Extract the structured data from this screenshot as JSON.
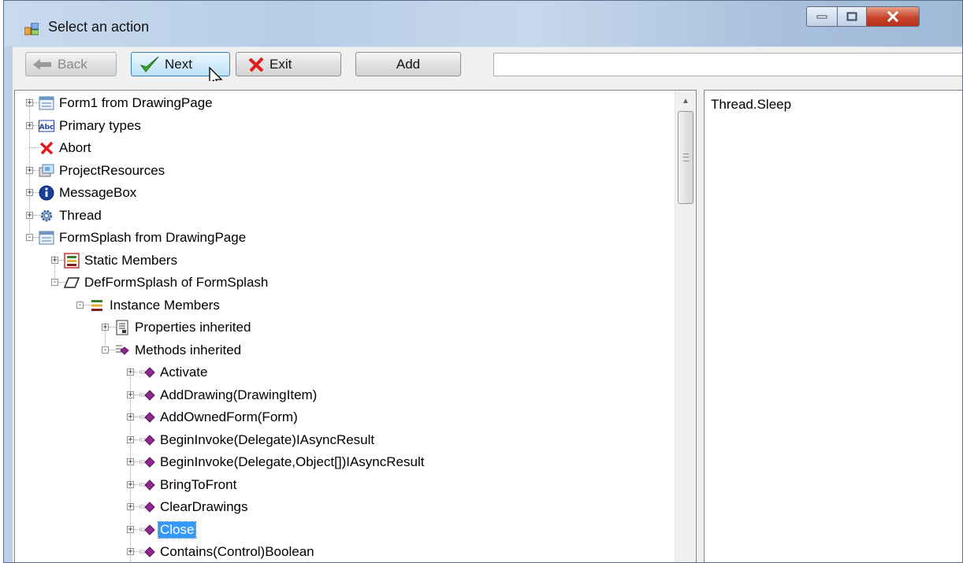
{
  "window": {
    "title": "Select an action"
  },
  "toolbar": {
    "back_label": "Back",
    "next_label": "Next",
    "exit_label": "Exit",
    "add_label": "Add",
    "address_value": ""
  },
  "detail": {
    "text": "Thread.Sleep"
  },
  "tree": {
    "items": [
      {
        "label": "Form1 from DrawingPage",
        "icon": "form-icon",
        "expander": "+",
        "selected": false
      },
      {
        "label": "Primary types",
        "icon": "abc-icon",
        "expander": "+",
        "selected": false
      },
      {
        "label": "Abort",
        "icon": "red-x-icon",
        "expander": "",
        "selected": false
      },
      {
        "label": "ProjectResources",
        "icon": "resources-icon",
        "expander": "+",
        "selected": false
      },
      {
        "label": "MessageBox",
        "icon": "info-icon",
        "expander": "+",
        "selected": false
      },
      {
        "label": "Thread",
        "icon": "gear-icon",
        "expander": "+",
        "selected": false
      },
      {
        "label": "FormSplash from DrawingPage",
        "icon": "form-icon",
        "expander": "-",
        "selected": false
      },
      {
        "label": "Static Members",
        "icon": "static-members-icon",
        "expander": "+",
        "selected": false
      },
      {
        "label": "DefFormSplash of FormSplash",
        "icon": "instance-icon",
        "expander": "-",
        "selected": false
      },
      {
        "label": "Instance Members",
        "icon": "members-icon",
        "expander": "-",
        "selected": false
      },
      {
        "label": "Properties inherited",
        "icon": "properties-icon",
        "expander": "+",
        "selected": false
      },
      {
        "label": "Methods inherited",
        "icon": "methods-icon",
        "expander": "-",
        "selected": false
      },
      {
        "label": "Activate",
        "icon": "method-icon",
        "expander": "+",
        "selected": false
      },
      {
        "label": "AddDrawing(DrawingItem)",
        "icon": "method-icon",
        "expander": "+",
        "selected": false
      },
      {
        "label": "AddOwnedForm(Form)",
        "icon": "method-icon",
        "expander": "+",
        "selected": false
      },
      {
        "label": "BeginInvoke(Delegate)IAsyncResult",
        "icon": "method-icon",
        "expander": "+",
        "selected": false
      },
      {
        "label": "BeginInvoke(Delegate,Object[])IAsyncResult",
        "icon": "method-icon",
        "expander": "+",
        "selected": false
      },
      {
        "label": "BringToFront",
        "icon": "method-icon",
        "expander": "+",
        "selected": false
      },
      {
        "label": "ClearDrawings",
        "icon": "method-icon",
        "expander": "+",
        "selected": false
      },
      {
        "label": "Close",
        "icon": "method-icon",
        "expander": "+",
        "selected": true
      },
      {
        "label": "Contains(Control)Boolean",
        "icon": "method-icon",
        "expander": "+",
        "selected": false
      }
    ]
  }
}
